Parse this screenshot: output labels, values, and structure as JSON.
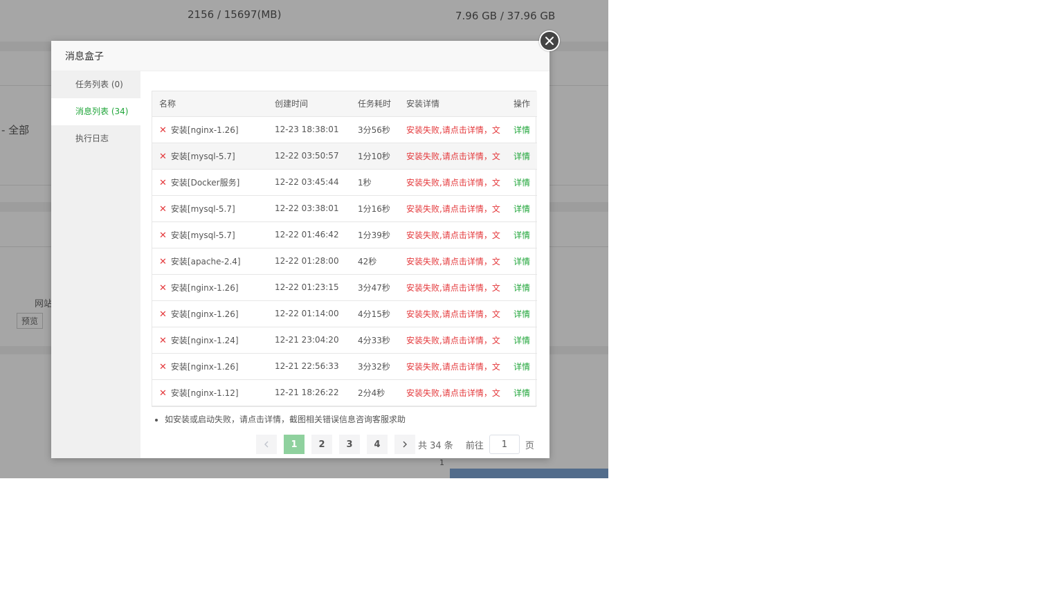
{
  "background": {
    "memory_usage": "2156 / 15697(MB)",
    "disk_usage": "7.96 GB / 37.96 GB",
    "filter_label": "- 全部",
    "site_label": "网站",
    "preview_button": "预览",
    "chart_tick": "1"
  },
  "dialog": {
    "title": "消息盒子",
    "sidebar": [
      {
        "label": "任务列表 (0)",
        "active": false
      },
      {
        "label": "消息列表 (34)",
        "active": true
      },
      {
        "label": "执行日志",
        "active": false
      }
    ],
    "table": {
      "headers": [
        "名称",
        "创建时间",
        "任务耗时",
        "安装详情",
        "操作"
      ],
      "rows": [
        {
          "name": "安装[nginx-1.26]",
          "time": "12-23 18:38:01",
          "duration": "3分56秒",
          "detail": "安装失败,请点击详情，文",
          "op": "详情"
        },
        {
          "name": "安装[mysql-5.7]",
          "time": "12-22 03:50:57",
          "duration": "1分10秒",
          "detail": "安装失败,请点击详情，文",
          "op": "详情"
        },
        {
          "name": "安装[Docker服务]",
          "time": "12-22 03:45:44",
          "duration": "1秒",
          "detail": "安装失败,请点击详情，文",
          "op": "详情"
        },
        {
          "name": "安装[mysql-5.7]",
          "time": "12-22 03:38:01",
          "duration": "1分16秒",
          "detail": "安装失败,请点击详情，文",
          "op": "详情"
        },
        {
          "name": "安装[mysql-5.7]",
          "time": "12-22 01:46:42",
          "duration": "1分39秒",
          "detail": "安装失败,请点击详情，文",
          "op": "详情"
        },
        {
          "name": "安装[apache-2.4]",
          "time": "12-22 01:28:00",
          "duration": "42秒",
          "detail": "安装失败,请点击详情，文",
          "op": "详情"
        },
        {
          "name": "安装[nginx-1.26]",
          "time": "12-22 01:23:15",
          "duration": "3分47秒",
          "detail": "安装失败,请点击详情，文",
          "op": "详情"
        },
        {
          "name": "安装[nginx-1.26]",
          "time": "12-22 01:14:00",
          "duration": "4分15秒",
          "detail": "安装失败,请点击详情，文",
          "op": "详情"
        },
        {
          "name": "安装[nginx-1.24]",
          "time": "12-21 23:04:20",
          "duration": "4分33秒",
          "detail": "安装失败,请点击详情，文",
          "op": "详情"
        },
        {
          "name": "安装[nginx-1.26]",
          "time": "12-21 22:56:33",
          "duration": "3分32秒",
          "detail": "安装失败,请点击详情，文",
          "op": "详情"
        },
        {
          "name": "安装[nginx-1.12]",
          "time": "12-21 18:26:22",
          "duration": "2分4秒",
          "detail": "安装失败,请点击详情，文",
          "op": "详情"
        }
      ]
    },
    "tip": "如安装或启动失败，请点击详情，截图相关错误信息咨询客服求助",
    "pagination": {
      "pages": [
        "1",
        "2",
        "3",
        "4"
      ],
      "current": "1",
      "total_text": "共 34 条",
      "goto_label": "前往",
      "goto_value": "1",
      "page_suffix": "页"
    }
  },
  "colors": {
    "accent_green": "#20a53a",
    "error_red": "#e4393c",
    "active_page_bg": "#8fd19e"
  }
}
